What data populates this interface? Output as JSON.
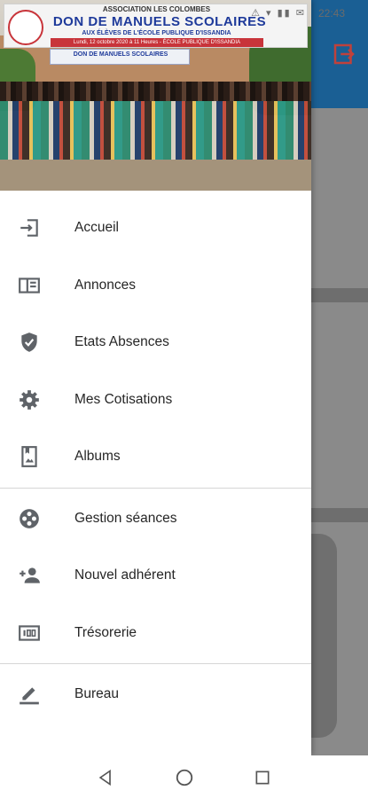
{
  "status_bar": {
    "icons_text": "⚠ ▾ ▮▮ ✉",
    "time": "22:43"
  },
  "header_image": {
    "association": "ASSOCIATION LES COLOMBES",
    "title": "DON DE MANUELS SCOLAIRES",
    "subtitle": "AUX ÉLÈVES DE L'ÉCOLE PUBLIQUE D'ISSANDIA",
    "strip": "Lundi, 12 octobre 2020 à 11 Heures - ÉCOLE PUBLIQUE D'ISSANDIA",
    "small_banner": "DON DE MANUELS SCOLAIRES"
  },
  "menu": {
    "group1": [
      {
        "label": "Accueil",
        "icon": "login-icon"
      },
      {
        "label": "Annonces",
        "icon": "announcement-card-icon"
      },
      {
        "label": "Etats Absences",
        "icon": "shield-check-icon"
      },
      {
        "label": "Mes Cotisations",
        "icon": "gear-icon"
      },
      {
        "label": "Albums",
        "icon": "photo-album-icon"
      }
    ],
    "group2": [
      {
        "label": "Gestion séances",
        "icon": "film-reel-icon"
      },
      {
        "label": "Nouvel adhérent",
        "icon": "person-add-icon"
      },
      {
        "label": "Trésorerie",
        "icon": "counter-100-icon"
      }
    ],
    "group3": [
      {
        "label": "Bureau",
        "icon": "edit-pen-icon"
      }
    ]
  },
  "colors": {
    "app_bar": "#1a5f94",
    "icon_gray": "#5f6368",
    "exit_icon": "#c0413b"
  }
}
